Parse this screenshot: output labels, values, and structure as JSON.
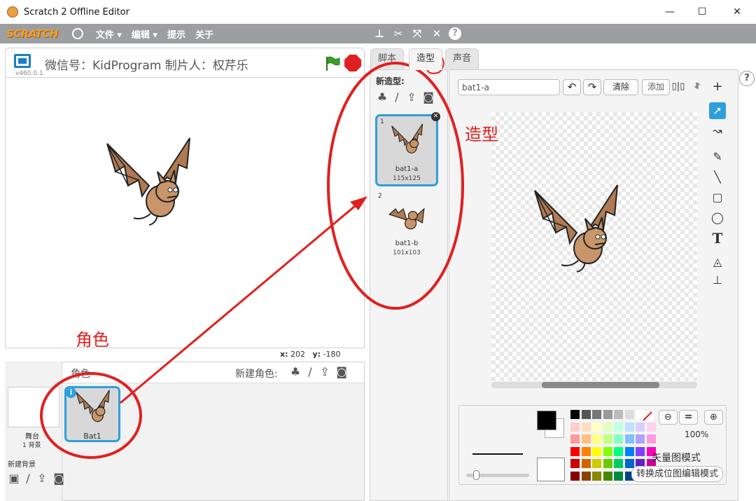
{
  "window": {
    "title": "Scratch 2 Offline Editor",
    "minimize_glyph": "—",
    "maximize_glyph": "☐",
    "close_glyph": "✕"
  },
  "menubar": {
    "logo": "SCRATCH",
    "menus": [
      "文件 ▾",
      "编辑 ▾",
      "提示",
      "关于"
    ],
    "tools": [
      "duplicate-icon",
      "delete-icon",
      "grow-icon",
      "shrink-icon",
      "help-icon"
    ]
  },
  "stage": {
    "caption": "微信号：KidProgram  制片人：权芹乐",
    "version": "v460.0.1",
    "coords": {
      "x_label": "x:",
      "x_value": "202",
      "y_label": "y:",
      "y_value": "-180"
    }
  },
  "sprites": {
    "header": "角色",
    "new_sprite_label": "新建角色:",
    "stage_label": "舞台",
    "backdrop_count": "1 背景",
    "new_backdrop_label": "新建背景",
    "items": [
      {
        "name": "Bat1"
      }
    ]
  },
  "tabs": [
    "脚本",
    "造型",
    "声音"
  ],
  "costumes": {
    "header": "新造型:",
    "items": [
      {
        "num": "1",
        "name": "bat1-a",
        "size": "115x125"
      },
      {
        "num": "2",
        "name": "bat1-b",
        "size": "101x103"
      }
    ]
  },
  "editor": {
    "costume_name": "bat1-a",
    "clear_label": "清除",
    "add_label": "添加",
    "zoom_level": "100%",
    "vector_mode_label": "矢量图模式",
    "convert_bitmap_label": "转换成位图编辑模式"
  },
  "palette": {
    "rows": [
      [
        "#000000",
        "#555555",
        "#777777",
        "#999999",
        "#bbbbbb",
        "#dddddd",
        "#ffffff",
        "#ffffff"
      ],
      [
        "#ffcccc",
        "#ffe0c0",
        "#ffffc0",
        "#e0ffc0",
        "#c0ffe0",
        "#c0e0ff",
        "#d8d0ff",
        "#ffd0f0"
      ],
      [
        "#ff9999",
        "#ffc080",
        "#ffff80",
        "#c0ff80",
        "#80ffc0",
        "#80c0ff",
        "#b0a0ff",
        "#ff99e0"
      ],
      [
        "#ff0000",
        "#ff8000",
        "#ffff00",
        "#80ff00",
        "#00ff80",
        "#0080ff",
        "#8040ff",
        "#ff00c0"
      ],
      [
        "#cc0000",
        "#cc6600",
        "#cccc00",
        "#66cc00",
        "#00cc66",
        "#0066cc",
        "#6020cc",
        "#cc0099"
      ],
      [
        "#880000",
        "#884400",
        "#888800",
        "#448800",
        "#008844",
        "#004488",
        "#400088",
        "#880066"
      ]
    ],
    "primary_color": "#000000",
    "secondary_color": "#ffffff"
  },
  "annotations": {
    "sprite_label": "角色",
    "costume_label": "造型",
    "color": "#e02020"
  }
}
